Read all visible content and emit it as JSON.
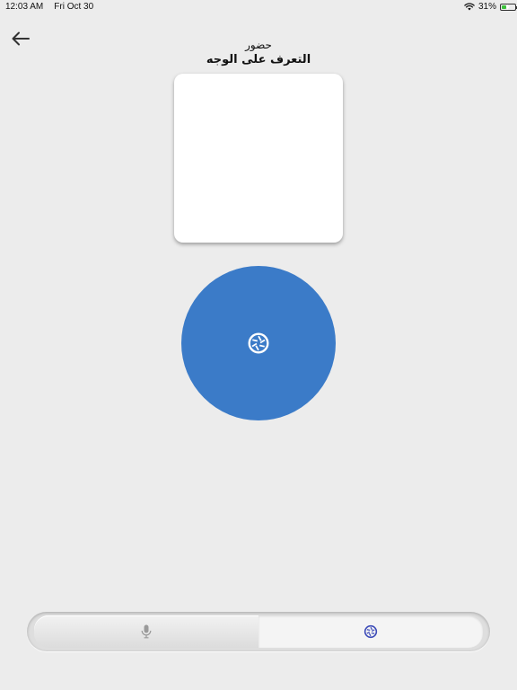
{
  "status_bar": {
    "time": "12:03 AM",
    "date": "Fri Oct 30",
    "battery_percent": "31%",
    "battery_level": 0.31,
    "icons": [
      "wifi-icon",
      "battery-icon",
      "charging-bolt-icon"
    ]
  },
  "header": {
    "back_icon": "arrow-left-icon",
    "subtitle": "حضور",
    "title": "التعرف على الوجه"
  },
  "capture": {
    "icon": "camera-shutter-icon",
    "color": "#3b7bc8"
  },
  "mode_switcher": {
    "tabs": [
      {
        "name": "voice",
        "icon": "microphone-icon",
        "selected": false
      },
      {
        "name": "face",
        "icon": "camera-shutter-icon",
        "selected": true
      }
    ],
    "accent_color": "#3c4bb8"
  }
}
